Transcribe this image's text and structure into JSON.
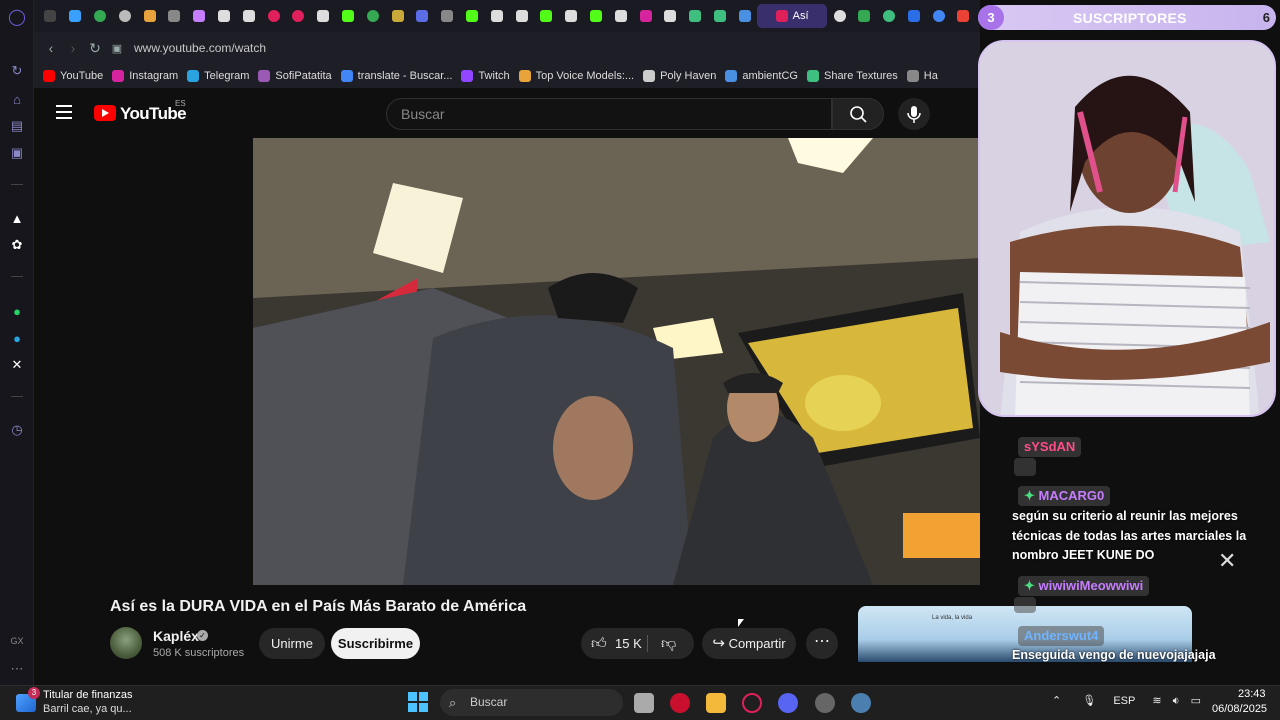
{
  "browser": {
    "active_tab_label": "Así",
    "url": "www.youtube.com/watch",
    "bookmarks": [
      {
        "label": "YouTube",
        "color": "#ff0000"
      },
      {
        "label": "Instagram",
        "color": "#d6249f"
      },
      {
        "label": "Telegram",
        "color": "#2aa3e1"
      },
      {
        "label": "SofiPatatita",
        "color": "#9b59b6"
      },
      {
        "label": "translate - Buscar...",
        "color": "#4285f4"
      },
      {
        "label": "Twitch",
        "color": "#9146ff"
      },
      {
        "label": "Top Voice Models:...",
        "color": "#e8a33a"
      },
      {
        "label": "Poly Haven",
        "color": "#cccccc"
      },
      {
        "label": "ambientCG",
        "color": "#4a90e2"
      },
      {
        "label": "Share Textures",
        "color": "#3fbf7f"
      },
      {
        "label": "Ha",
        "color": "#888888"
      }
    ]
  },
  "youtube": {
    "logo_text": "YouTube",
    "region": "ES",
    "search_placeholder": "Buscar",
    "video_title": "Así es la DURA VIDA en el País Más Barato de América",
    "channel_name": "Kapléx",
    "subscribers": "508 K suscriptores",
    "join_label": "Unirme",
    "subscribe_label": "Suscribirme",
    "likes": "15 K",
    "share_label": "Compartir",
    "suggestion_caption": "La vida, la vida"
  },
  "overlay": {
    "banner_count_left": "3",
    "banner_text": "SUSCRIPTORES",
    "banner_count_right": "6",
    "chat": [
      {
        "name": "sYSdAN",
        "name_color": "#ff4d8a",
        "message": ""
      },
      {
        "name": "MACARG0",
        "name_color": "#c77dff",
        "message": "según su criterio al reunir las mejores técnicas de todas las artes marciales la nombro JEET KUNE DO"
      },
      {
        "name": "wiwiwiMeowwiwi",
        "name_color": "#c77dff",
        "message": ""
      },
      {
        "name": "Anderswut4",
        "name_color": "#6fb4ff",
        "message": "Enseguida vengo de nuevojajajaja"
      }
    ]
  },
  "taskbar": {
    "news_badge": "3",
    "news_title": "Titular de finanzas",
    "news_subtitle": "Barril cae, ya qu...",
    "search_label": "Buscar",
    "language": "ESP",
    "time": "23:43",
    "date": "06/08/2025"
  },
  "colors": {
    "accent": "#ff0000",
    "background": "#0f0f0f",
    "sidebar_icon": "#8a88c8"
  }
}
